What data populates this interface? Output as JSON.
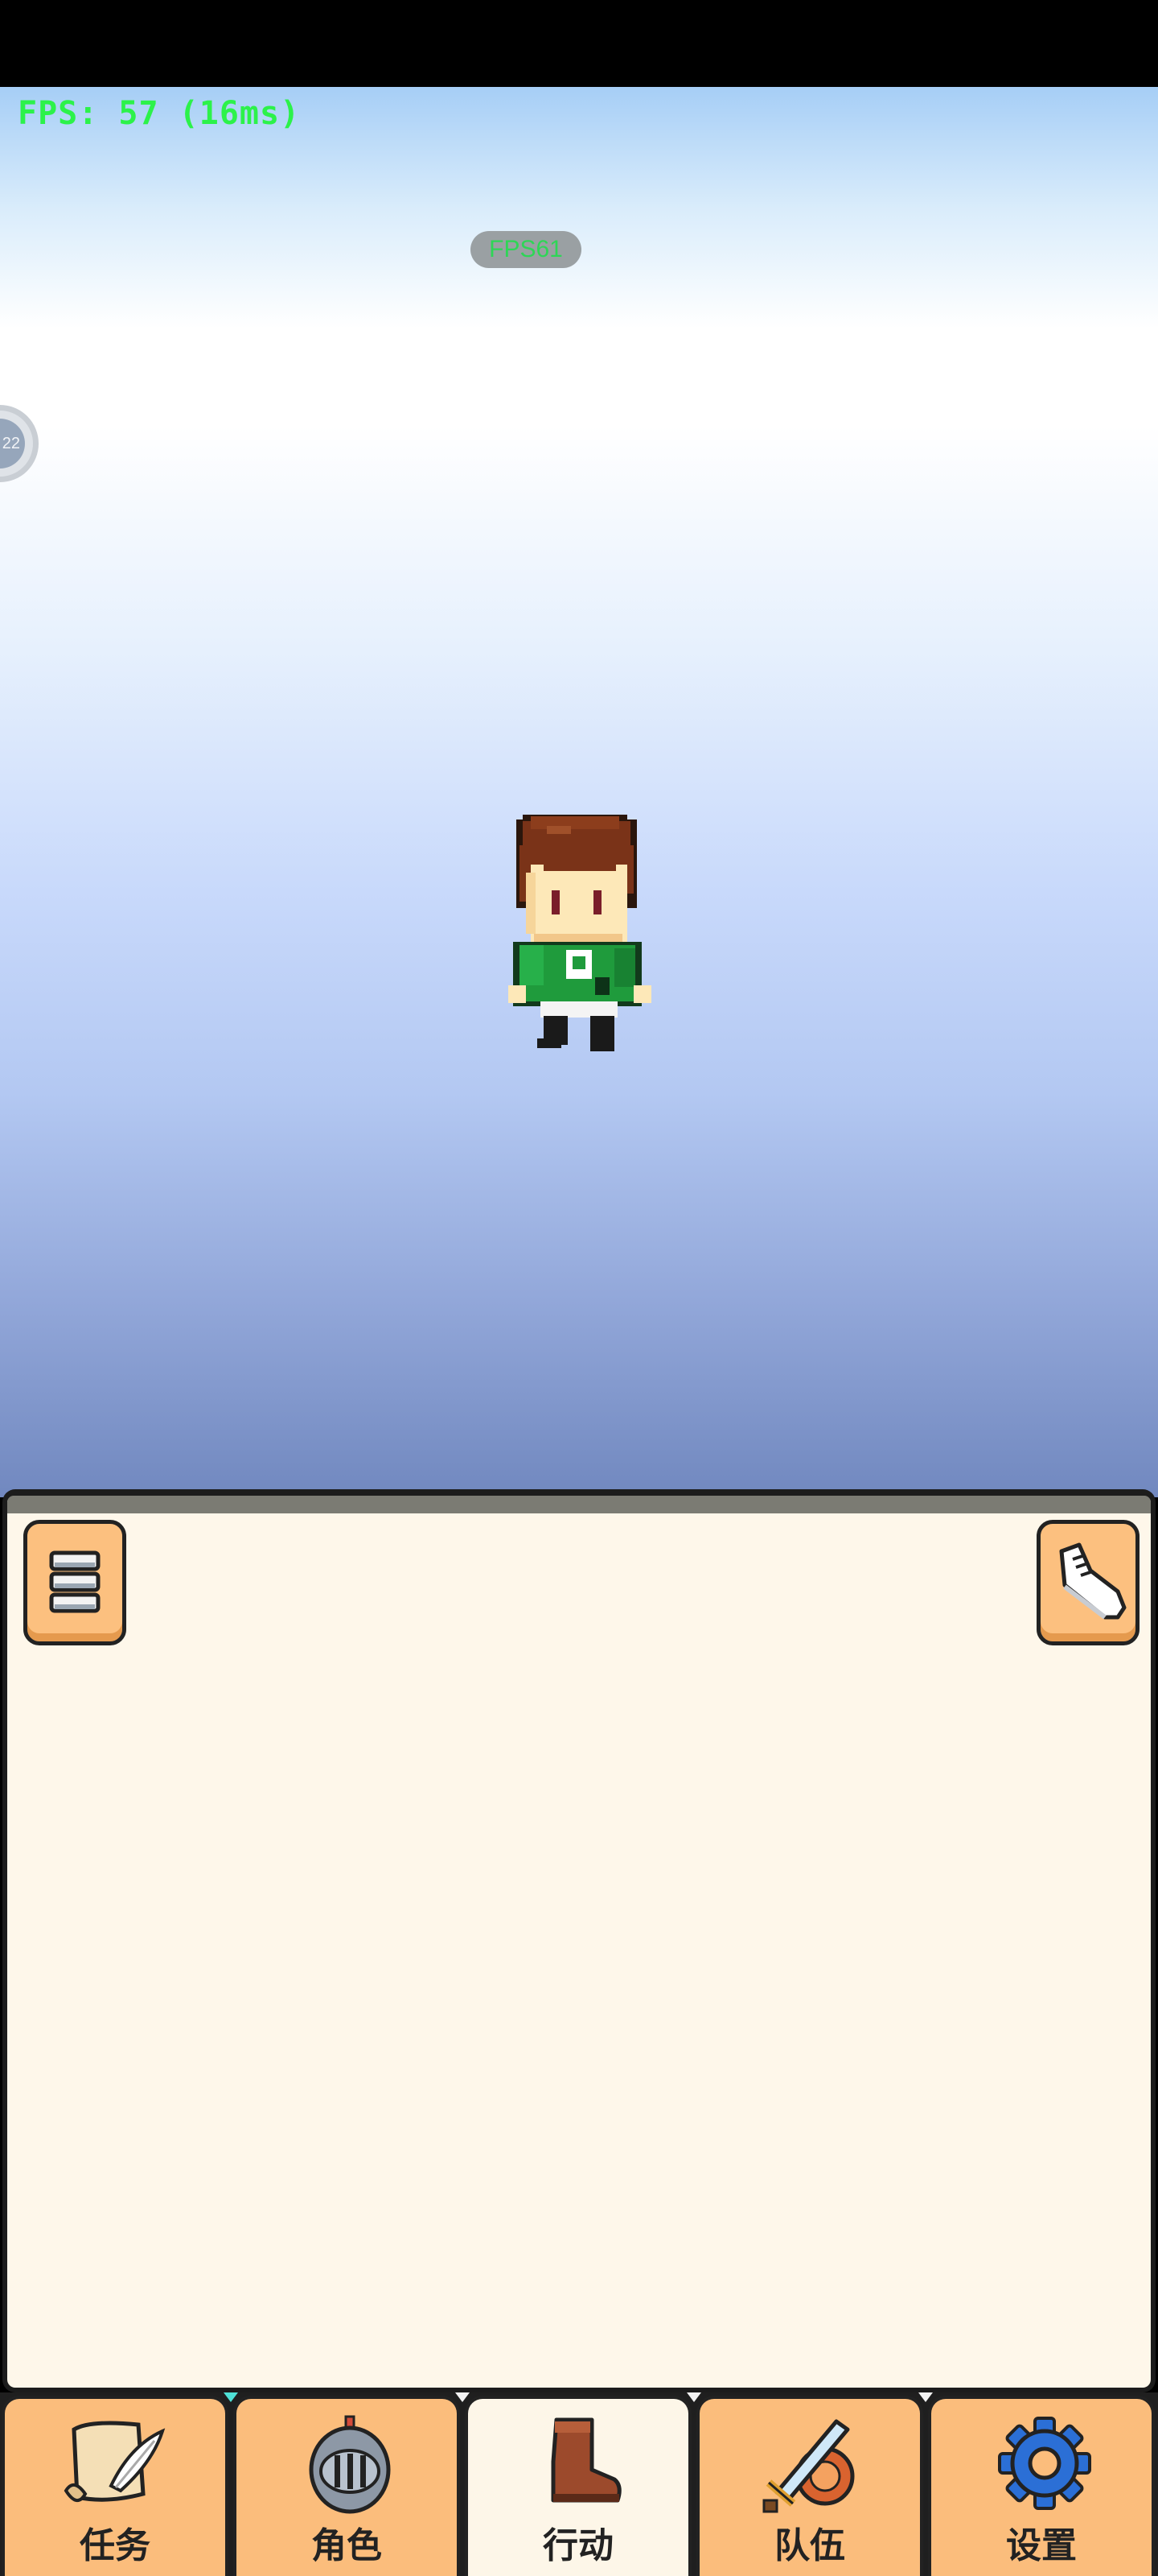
{
  "hud": {
    "fps_debug": "FPS: 57 (16ms)",
    "fps_badge": "FPS61",
    "float_ball_text": "22"
  },
  "tabs": [
    {
      "label": "任务",
      "icon": "scroll-quill-icon"
    },
    {
      "label": "角色",
      "icon": "knight-helmet-icon"
    },
    {
      "label": "行动",
      "icon": "boot-icon",
      "active": true
    },
    {
      "label": "队伍",
      "icon": "sword-shield-icon"
    },
    {
      "label": "设置",
      "icon": "gear-icon"
    }
  ],
  "panel": {
    "left_button_icon": "menu-list-icon",
    "right_button_icon": "sneaker-icon"
  },
  "colors": {
    "panel_bg": "#fef7ea",
    "button_orange": "#fcc07f",
    "fps_green": "#2cf24a"
  }
}
